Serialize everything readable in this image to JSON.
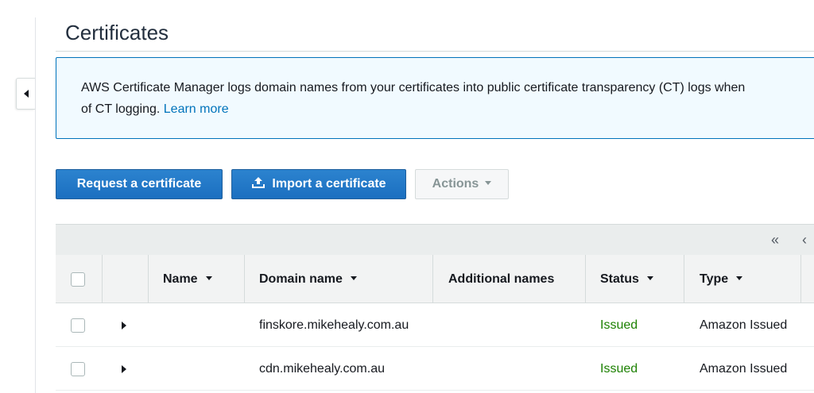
{
  "page": {
    "title": "Certificates"
  },
  "info_banner": {
    "text_line1": "AWS Certificate Manager logs domain names from your certificates into public certificate transparency (CT) logs when",
    "text_line2": "of CT logging.",
    "link_text": "Learn more"
  },
  "toolbar": {
    "request_label": "Request a certificate",
    "import_label": "Import a certificate",
    "actions_label": "Actions"
  },
  "pagination": {
    "first_symbol": "«",
    "prev_symbol": "‹"
  },
  "table": {
    "columns": [
      {
        "label": "Name",
        "sortable": true
      },
      {
        "label": "Domain name",
        "sortable": true
      },
      {
        "label": "Additional names",
        "sortable": false
      },
      {
        "label": "Status",
        "sortable": true
      },
      {
        "label": "Type",
        "sortable": true
      }
    ],
    "rows": [
      {
        "name": "",
        "domain": "finskore.mikehealy.com.au",
        "additional": "",
        "status": "Issued",
        "type": "Amazon Issued"
      },
      {
        "name": "",
        "domain": "cdn.mikehealy.com.au",
        "additional": "",
        "status": "Issued",
        "type": "Amazon Issued"
      }
    ]
  },
  "colors": {
    "primary_button": "#1b6fc0",
    "link": "#0073bb",
    "status_issued": "#1d8102",
    "info_border": "#0073bb",
    "info_background": "#f1faff"
  },
  "icons": {
    "nav_toggle": "caret-left-icon",
    "import": "upload-icon",
    "actions": "caret-down-icon",
    "row_expand": "caret-right-icon"
  }
}
